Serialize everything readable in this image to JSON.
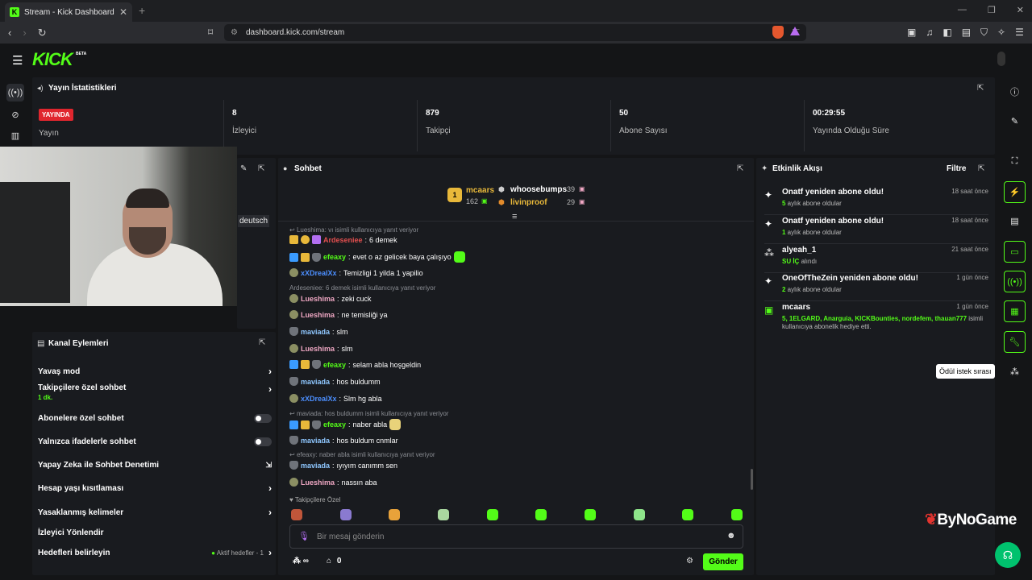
{
  "browser": {
    "tab_title": "Stream - Kick Dashboard",
    "url": "dashboard.kick.com/stream"
  },
  "app": {
    "logo": "KICK",
    "logo_badge": "BETA",
    "accent": "#53fc18"
  },
  "stats": {
    "title": "Yayın İstatistikleri",
    "live_badge": "YAYINDA",
    "items": [
      {
        "value": "",
        "label": "Yayın"
      },
      {
        "value": "8",
        "label": "İzleyici"
      },
      {
        "value": "879",
        "label": "Takipçi"
      },
      {
        "value": "50",
        "label": "Abone Sayısı"
      },
      {
        "value": "00:29:55",
        "label": "Yayında Olduğu Süre"
      }
    ]
  },
  "language_tag": "deutsch",
  "channel_actions": {
    "title": "Kanal Eylemleri",
    "rows": [
      {
        "label": "Yavaş mod",
        "sub": "",
        "control": "chevron"
      },
      {
        "label": "Takipçilere özel sohbet",
        "sub": "1 dk.",
        "control": "chevron"
      },
      {
        "label": "Abonelere özel sohbet",
        "sub": "",
        "control": "toggle"
      },
      {
        "label": "Yalnızca ifadelerle sohbet",
        "sub": "",
        "control": "toggle"
      },
      {
        "label": "Yapay Zeka ile Sohbet Denetimi",
        "sub": "",
        "control": "external"
      },
      {
        "label": "Hesap yaşı kısıtlaması",
        "sub": "",
        "control": "chevron"
      },
      {
        "label": "Yasaklanmış kelimeler",
        "sub": "",
        "control": "chevron"
      },
      {
        "label": "İzleyici Yönlendir",
        "sub": "",
        "control": ""
      },
      {
        "label": "Hedefleri belirleyin",
        "sub": "",
        "control": "chevron",
        "status": "Aktif hedefler - 1"
      }
    ]
  },
  "chat": {
    "title": "Sohbet",
    "leaderboard": {
      "top_name": "mcaars",
      "top_count": "162",
      "second_name": "whoosebumps",
      "second_count": "39",
      "third_name": "livinproof",
      "third_count": "29"
    },
    "reply_lines": [
      "Lueshima: vı isimli kullanıcıya yanıt veriyor",
      "Ardeseniee: 6 demek isimli kullanıcıya yanıt veriyor",
      "maviada: hos buldumm isimli kullanıcıya yanıt veriyor",
      "efeaxy: naber abla      isimli kullanıcıya yanıt veriyor"
    ],
    "messages": [
      {
        "user": "Ardeseniee",
        "text": "6 demek",
        "color": "#e34f4f"
      },
      {
        "user": "efeaxy",
        "text": "evet o az gelicek baya çalışıyo",
        "color": "#53fc18"
      },
      {
        "user": "xXDrealXx",
        "text": "Temizligi 1 yilda 1 yapilio",
        "color": "#4c8fff"
      },
      {
        "user": "Lueshima",
        "text": "zeki cuck",
        "color": "#f0a8c4"
      },
      {
        "user": "Lueshima",
        "text": "ne temisliği ya",
        "color": "#f0a8c4"
      },
      {
        "user": "maviada",
        "text": "slm",
        "color": "#8fc7ff"
      },
      {
        "user": "Lueshima",
        "text": "slm",
        "color": "#f0a8c4"
      },
      {
        "user": "efeaxy",
        "text": "selam abla hoşgeldin",
        "color": "#53fc18"
      },
      {
        "user": "maviada",
        "text": "hos buldumm",
        "color": "#8fc7ff"
      },
      {
        "user": "xXDrealXx",
        "text": "Slm hg abla",
        "color": "#4c8fff"
      },
      {
        "user": "efeaxy",
        "text": "naber abla",
        "color": "#53fc18"
      },
      {
        "user": "maviada",
        "text": "hos buldum cnmlar",
        "color": "#8fc7ff"
      },
      {
        "user": "maviada",
        "text": "ıyıyım canımm sen",
        "color": "#8fc7ff"
      },
      {
        "user": "Lueshima",
        "text": "nassın aba",
        "color": "#f0a8c4"
      }
    ],
    "followers_only_label": "Takipçilere Özel",
    "input_placeholder": "Bir mesaj gönderin",
    "send_label": "Gönder",
    "points_label": "∞",
    "store_count": "0"
  },
  "activity": {
    "title": "Etkinlik Akışı",
    "filter_label": "Filtre",
    "items": [
      {
        "title": "Onatf yeniden abone oldu!",
        "num": "5",
        "rest": " aylık abone oldular",
        "time": "18 saat önce"
      },
      {
        "title": "Onatf yeniden abone oldu!",
        "num": "1",
        "rest": " aylık abone oldular",
        "time": "18 saat önce"
      },
      {
        "title": "alyeah_1",
        "num": "SU İÇ",
        "rest": " alındı",
        "time": "21 saat önce"
      },
      {
        "title": "OneOfTheZein yeniden abone oldu!",
        "num": "2",
        "rest": " aylık abone oldular",
        "time": "1 gün önce"
      },
      {
        "title": "mcaars",
        "num": "5, 1ELGARD, Anarguia, KICKBounties, nordefem, thauan777",
        "rest": " isimli",
        "rest2": "kullanıcıya abonelik hediye etti.",
        "time": "1 gün önce"
      }
    ]
  },
  "tooltip": "Ödül istek sırası",
  "watermark": "ByNoGame"
}
